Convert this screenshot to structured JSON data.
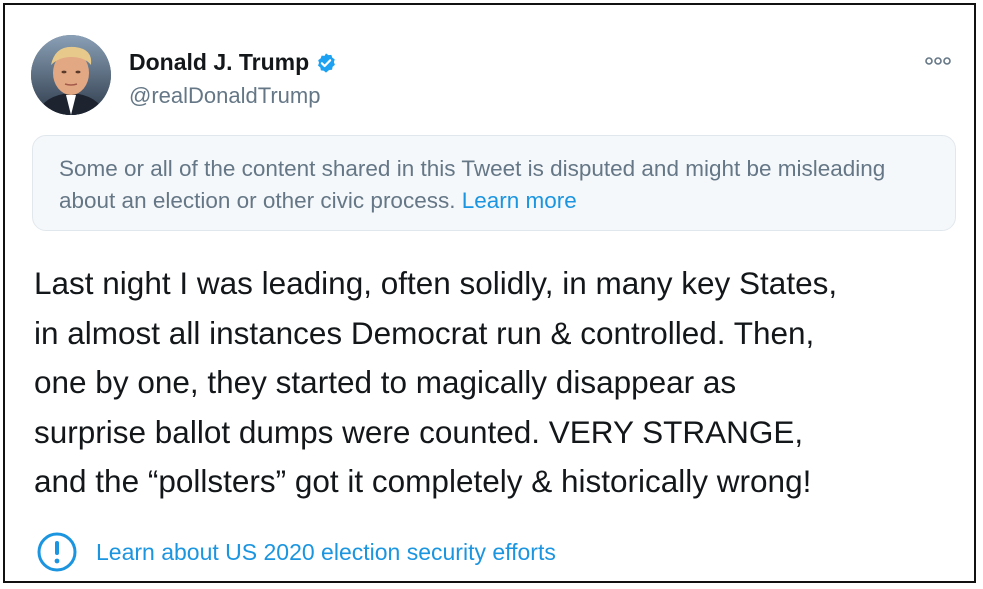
{
  "user": {
    "name": "Donald J. Trump",
    "handle": "@realDonaldTrump",
    "verified_icon": "verified-badge-icon",
    "avatar_icon": "profile-avatar"
  },
  "more_menu_icon": "more-options-icon",
  "notice": {
    "text": "Some or all of the content shared in this Tweet is disputed and might be misleading about an election or other civic process.",
    "link": "Learn more"
  },
  "tweet": {
    "lines": [
      "Last night I was leading, often solidly, in many key States,",
      "in almost all instances Democrat run & controlled. Then,",
      "one by one, they started to magically disappear as",
      "surprise ballot dumps were counted. VERY STRANGE,",
      "and the “pollsters” got it completely & historically wrong!"
    ]
  },
  "election_link": {
    "icon": "exclamation-circle-icon",
    "label": "Learn about US 2020 election security efforts"
  },
  "colors": {
    "accent": "#1b95e0",
    "verified": "#1da1f2",
    "text": "#14171a",
    "secondary_text": "#657786",
    "notice_background": "#f5f8fa"
  }
}
